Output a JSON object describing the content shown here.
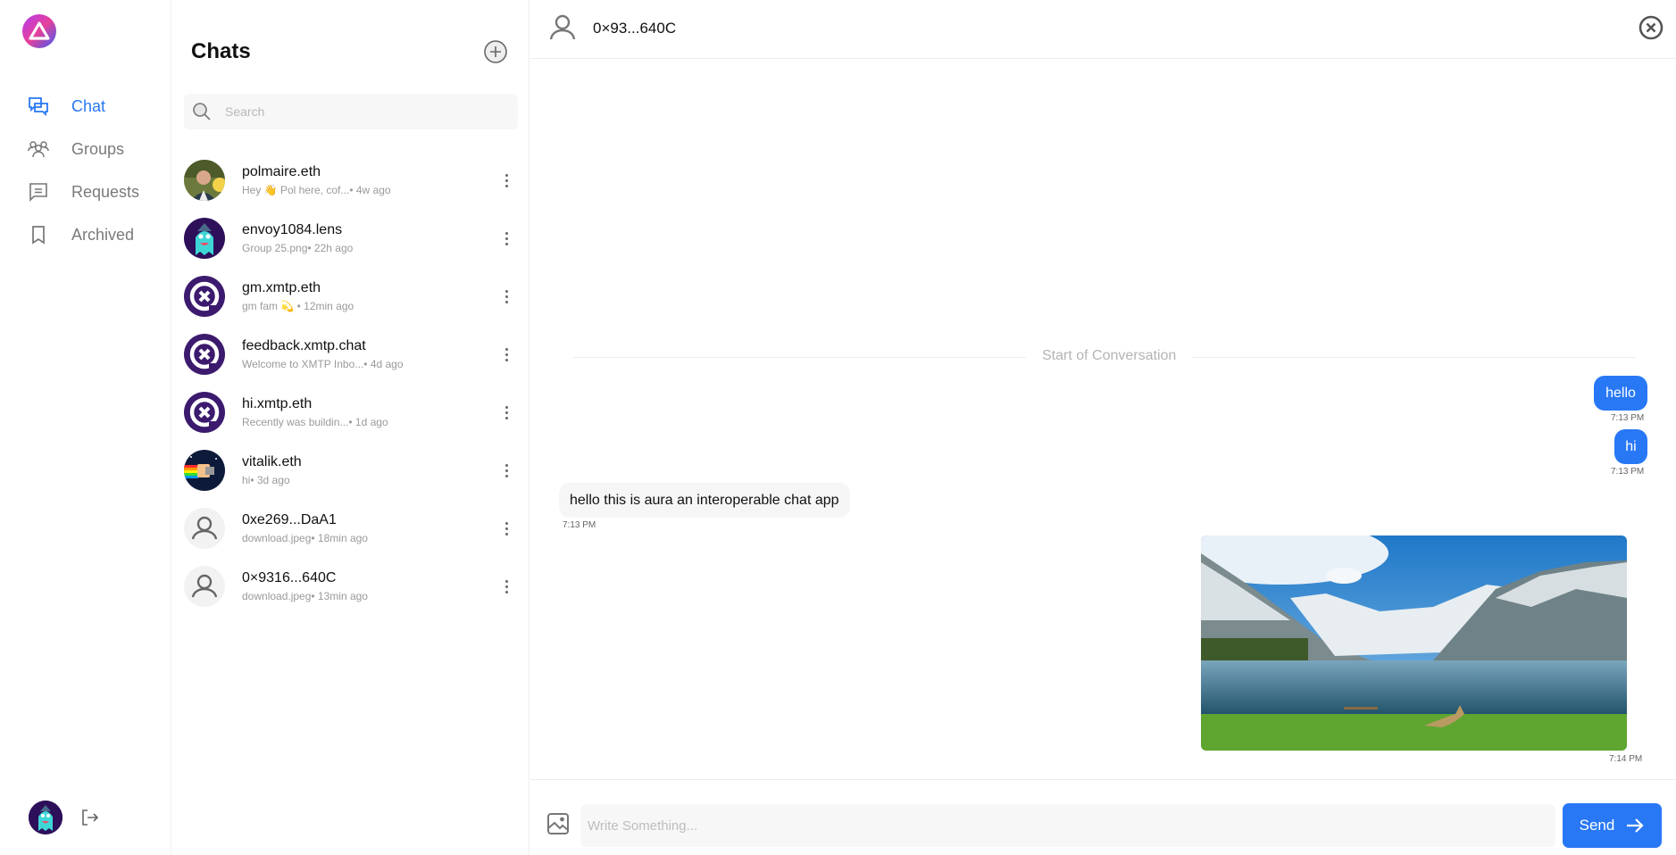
{
  "app": {
    "accent": "#2878f5"
  },
  "nav": {
    "items": [
      {
        "label": "Chat",
        "icon": "chat-bubbles-icon",
        "active": true
      },
      {
        "label": "Groups",
        "icon": "group-icon",
        "active": false
      },
      {
        "label": "Requests",
        "icon": "message-square-icon",
        "active": false
      },
      {
        "label": "Archived",
        "icon": "bookmark-icon",
        "active": false
      }
    ]
  },
  "chat_list": {
    "title": "Chats",
    "search_placeholder": "Search",
    "conversations": [
      {
        "name": "polmaire.eth",
        "preview": "Hey 👋 Pol here, cof...• 4w ago",
        "avatar": "photo"
      },
      {
        "name": "envoy1084.lens",
        "preview": "Group 25.png• 22h ago",
        "avatar": "ghost"
      },
      {
        "name": "gm.xmtp.eth",
        "preview": "gm fam 💫 • 12min ago",
        "avatar": "xmtp"
      },
      {
        "name": "feedback.xmtp.chat",
        "preview": "Welcome to XMTP Inbo...• 4d ago",
        "avatar": "xmtp"
      },
      {
        "name": "hi.xmtp.eth",
        "preview": "Recently was buildin...• 1d ago",
        "avatar": "xmtp"
      },
      {
        "name": "vitalik.eth",
        "preview": "hi• 3d ago",
        "avatar": "nyan"
      },
      {
        "name": "0xe269...DaA1",
        "preview": "download.jpeg• 18min ago",
        "avatar": "default"
      },
      {
        "name": "0×9316...640C",
        "preview": "download.jpeg• 13min ago",
        "avatar": "default"
      }
    ]
  },
  "conversation": {
    "peer": "0×93...640C",
    "start_label": "Start of Conversation",
    "messages": [
      {
        "direction": "out",
        "text": "hello",
        "time": "7:13 PM"
      },
      {
        "direction": "out",
        "text": "hi",
        "time": "7:13 PM"
      },
      {
        "direction": "in",
        "text": "hello this is aura an interoperable chat app",
        "time": "7:13 PM"
      },
      {
        "direction": "out",
        "type": "image",
        "alt": "mountain lake landscape",
        "time": "7:14 PM"
      }
    ],
    "composer": {
      "placeholder": "Write Something...",
      "send_label": "Send"
    }
  }
}
